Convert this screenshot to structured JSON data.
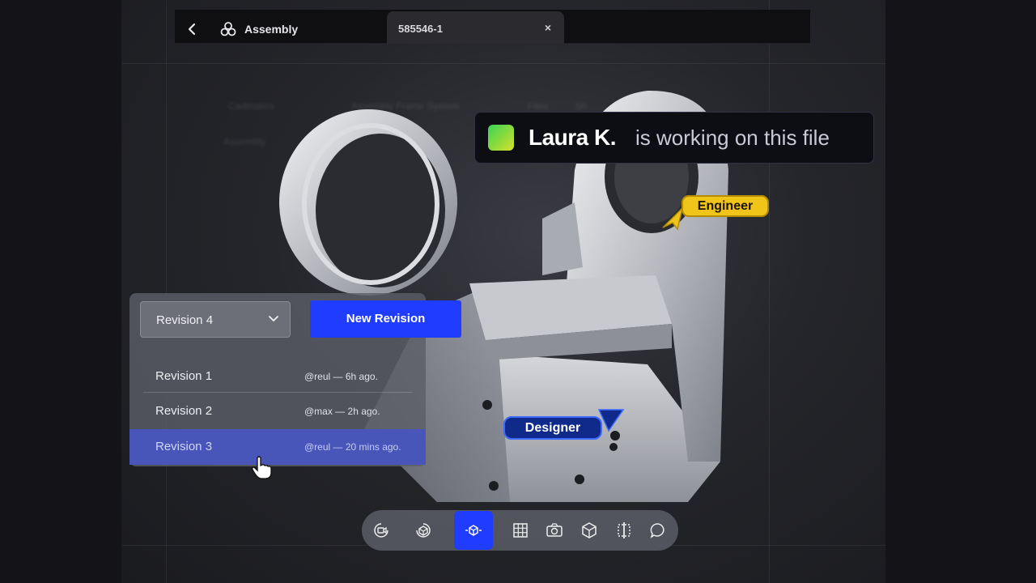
{
  "header": {
    "back_icon": "chevron-left-icon",
    "app_icon": "assembly-icon",
    "app_name": "Assembly",
    "tab_title": "585546-1",
    "tab_close": "×"
  },
  "background_menu": {
    "items": [
      "Cadmatics",
      "Assembly Frame System",
      "Files",
      "Sh",
      "Assembly"
    ]
  },
  "presence": {
    "user_name": "Laura K.",
    "message": "is working on this file",
    "swatch_color": "#39d353"
  },
  "cursors": {
    "engineer_label": "Engineer",
    "engineer_color": "#f0c419",
    "designer_label": "Designer",
    "designer_color": "#102a8c"
  },
  "revisions": {
    "selected_value": "Revision 4",
    "new_button_label": "New Revision",
    "items": [
      {
        "label": "Revision 1",
        "meta": "@reul — 6h ago."
      },
      {
        "label": "Revision 2",
        "meta": "@max — 2h ago."
      },
      {
        "label": "Revision 3",
        "meta": "@reul — 20 mins ago."
      }
    ],
    "highlighted_index": 2
  },
  "toolbar": {
    "tools": [
      "rotate-camera-icon",
      "orbit-icon",
      "pan-cube-icon",
      "grid-icon",
      "camera-icon",
      "cube-icon",
      "section-icon",
      "comment-icon"
    ],
    "active_tool": "pan-cube-icon",
    "accent_color": "#1f3cff"
  }
}
